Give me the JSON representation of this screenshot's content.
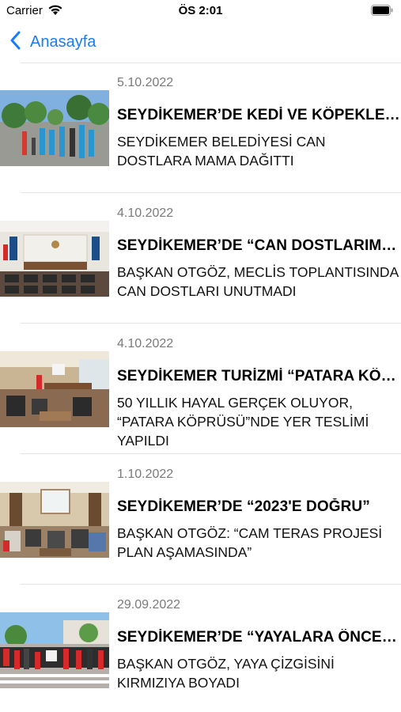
{
  "status_bar": {
    "carrier": "Carrier",
    "time": "ÖS 2:01"
  },
  "nav": {
    "back_label": "Anasayfa"
  },
  "colors": {
    "accent": "#1a7cf5",
    "separator": "#e4e4e4",
    "date": "#7a7a7a"
  },
  "news": [
    {
      "date": "5.10.2022",
      "title": "SEYDİKEMER’DE KEDİ VE KÖPEKLERE",
      "summary": "SEYDİKEMER BELEDİYESİ CAN DOSTLARA MAMA DAĞITTI",
      "thumb": "thumb-1"
    },
    {
      "date": "4.10.2022",
      "title": "SEYDİKEMER’DE “CAN DOSTLARIMIZ”",
      "summary": "BAŞKAN OTGÖZ, MECLİS TOPLANTISINDA CAN DOSTLARI UNUTMADI",
      "thumb": "thumb-2"
    },
    {
      "date": "4.10.2022",
      "title": "SEYDİKEMER TURİZMİ “PATARA KÖPRÜSÜ”",
      "summary": "50 YILLIK HAYAL GERÇEK OLUYOR, “PATARA KÖPRÜSÜ”NDE YER TESLİMİ YAPILDI",
      "thumb": "thumb-3"
    },
    {
      "date": "1.10.2022",
      "title": "SEYDİKEMER’DE “2023'E DOĞRU”",
      "summary": "BAŞKAN OTGÖZ: “CAM TERAS PROJESİ PLAN AŞAMASINDA”",
      "thumb": "thumb-4"
    },
    {
      "date": "29.09.2022",
      "title": "SEYDİKEMER’DE “YAYALARA ÖNCELİK”",
      "summary": "BAŞKAN OTGÖZ, YAYA ÇİZGİSİNİ KIRMIZIYA BOYADI",
      "thumb": "thumb-5"
    }
  ]
}
